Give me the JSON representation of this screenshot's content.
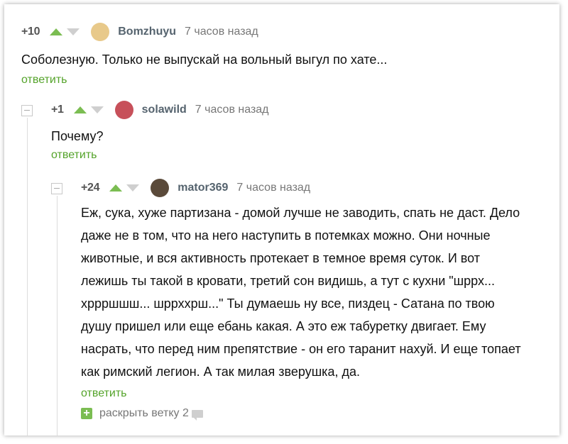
{
  "comments": [
    {
      "rating": "+10",
      "username": "Bomzhuyu",
      "time": "7 часов назад",
      "text": "Соболезную. Только не выпускай на вольный выгул по хате...",
      "reply": "ответить",
      "avatar_color": "#e8c98a"
    },
    {
      "rating": "+1",
      "username": "solawild",
      "time": "7 часов назад",
      "text": "Почему?",
      "reply": "ответить",
      "avatar_color": "#c7505a"
    },
    {
      "rating": "+24",
      "username": "mator369",
      "time": "7 часов назад",
      "lines": [
        "Еж, сука, хуже партизана - домой лучше не заводить, спать не даст. Дело",
        "даже не в том, что на него наступить в потемках можно. Они ночные",
        "животные, и вся активность протекает в  темное время суток. И вот",
        "лежишь ты такой в кровати, третий сон видишь, а тут с кухни \"шррх...",
        "хррршшш... шррхxрш...\" Ты думаешь ну все, пиздец - Сатана по твою",
        "душу пришел или еще ебань какая. А это еж табуретку двигает. Ему",
        "насрать, что перед ним препятствие - он его таранит нахуй. И еще топает",
        "как римский легион. А так милая зверушка, да."
      ],
      "reply": "ответить",
      "avatar_color": "#5a4a3a"
    }
  ],
  "expand": {
    "label": "раскрыть ветку 2",
    "plus": "+"
  },
  "icons": [
    "arrow-up-icon",
    "arrow-down-icon",
    "collapse-icon",
    "expand-icon",
    "comment-icon"
  ],
  "colors": {
    "accent": "#54a32a",
    "upvote": "#7bbd52",
    "downvote": "#cfcfcf"
  }
}
